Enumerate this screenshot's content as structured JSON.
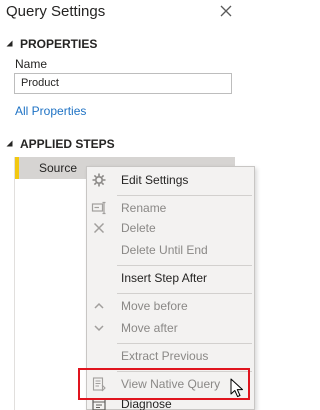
{
  "panel": {
    "title": "Query Settings"
  },
  "properties": {
    "heading": "PROPERTIES",
    "name_label": "Name",
    "name_value": "Product",
    "all_properties_link": "All Properties"
  },
  "applied_steps": {
    "heading": "APPLIED STEPS",
    "steps": [
      {
        "label": "Source",
        "selected": true
      }
    ]
  },
  "context_menu": {
    "items": [
      {
        "label": "Edit Settings",
        "icon": "gear-icon",
        "enabled": true
      },
      {
        "label": "Rename",
        "icon": "rename-icon",
        "enabled": false
      },
      {
        "label": "Delete",
        "icon": "delete-x-icon",
        "enabled": false
      },
      {
        "label": "Delete Until End",
        "icon": "",
        "enabled": false
      },
      {
        "label": "Insert Step After",
        "icon": "",
        "enabled": true
      },
      {
        "label": "Move before",
        "icon": "chevron-up-icon",
        "enabled": false
      },
      {
        "label": "Move after",
        "icon": "chevron-down-icon",
        "enabled": false
      },
      {
        "label": "Extract Previous",
        "icon": "",
        "enabled": false
      },
      {
        "label": "View Native Query",
        "icon": "native-query-icon",
        "enabled": false
      },
      {
        "label": "Diagnose",
        "icon": "diagnose-icon",
        "enabled": true
      }
    ]
  },
  "colors": {
    "accent_yellow": "#f2c811",
    "link_blue": "#1e72c4",
    "highlight_red": "#e0141e"
  }
}
